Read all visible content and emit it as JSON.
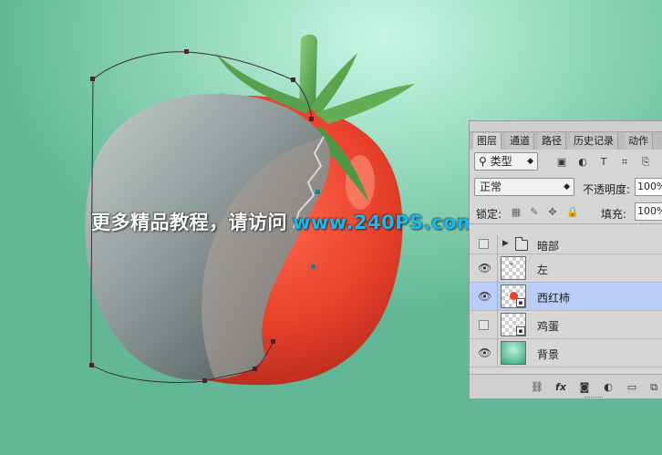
{
  "watermark": {
    "text": "更多精品教程，请访问",
    "url": "www.240PS.com"
  },
  "layers_panel": {
    "tabs": [
      {
        "label": "图层",
        "active": true
      },
      {
        "label": "通道",
        "active": false
      },
      {
        "label": "路径",
        "active": false
      },
      {
        "label": "历史记录",
        "active": false
      },
      {
        "label": "动作",
        "active": false
      }
    ],
    "filter": {
      "kind_label": "类型",
      "kind_icon": "search-icon"
    },
    "filter_icons": [
      "image-filter-icon",
      "adjustment-filter-icon",
      "type-filter-icon",
      "shape-filter-icon",
      "smart-object-filter-icon"
    ],
    "blend_mode": "正常",
    "opacity_label": "不透明度:",
    "opacity_value": "100%",
    "lock_label": "锁定:",
    "lock_icons": [
      "lock-transparent-icon",
      "lock-image-icon",
      "lock-position-icon",
      "lock-all-icon"
    ],
    "fill_label": "填充:",
    "fill_value": "100%",
    "layers": [
      {
        "name": "暗部",
        "type": "group",
        "visible": false,
        "selected": false
      },
      {
        "name": "左",
        "type": "pixel",
        "visible": true,
        "selected": false
      },
      {
        "name": "西红柿",
        "type": "smart",
        "visible": true,
        "selected": true
      },
      {
        "name": "鸡蛋",
        "type": "smart",
        "visible": false,
        "selected": false
      },
      {
        "name": "背景",
        "type": "background",
        "visible": true,
        "selected": false
      }
    ],
    "bottom_icons": [
      "link-icon",
      "fx-icon",
      "mask-icon",
      "adjustment-icon",
      "folder-icon",
      "new-layer-icon"
    ],
    "bottom_fx_label": "fx"
  },
  "colors": {
    "canvas_light": "#c8f6e6",
    "canvas_dark": "#62b896",
    "tomato": "#e8402b",
    "eggshell": "#9ea9a8",
    "url_blue": "#19b9ee",
    "selection": "#b9cdf6"
  }
}
